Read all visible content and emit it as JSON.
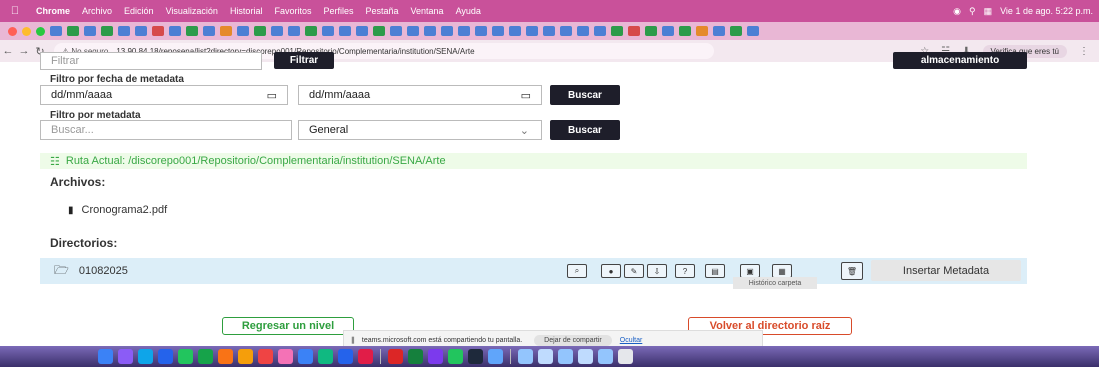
{
  "menubar": {
    "app": "Chrome",
    "items": [
      "Archivo",
      "Edición",
      "Visualización",
      "Historial",
      "Favoritos",
      "Perfiles",
      "Pestaña",
      "Ventana",
      "Ayuda"
    ],
    "clock": "Vie 1 de ago.  5:22 p.m."
  },
  "toolbar": {
    "security": "No seguro",
    "url": "13.90.84.18/reposena/list?directory=discorepo001/Repositorio/Complementaria/institution/SENA/Arte",
    "verify": "Verifica que eres tú"
  },
  "filters": {
    "filter_placeholder": "Filtrar",
    "filter_button": "Filtrar",
    "storage_button": "almacenamiento",
    "date_label": "Filtro por fecha de metadata",
    "date_from": "dd/mm/aaaa",
    "date_to": "dd/mm/aaaa",
    "search_button": "Buscar",
    "meta_label": "Filtro por metadata",
    "meta_placeholder": "Buscar...",
    "meta_select": "General",
    "meta_button": "Buscar"
  },
  "path": {
    "text": "Ruta Actual: /discorepo001/Repositorio/Complementaria/institution/SENA/Arte"
  },
  "files": {
    "title": "Archivos:",
    "items": [
      "Cronograma2.pdf"
    ]
  },
  "directories": {
    "title": "Directorios:",
    "items": [
      "01082025"
    ],
    "insert_button": "Insertar Metadata",
    "tooltip": "Histórico carpeta"
  },
  "footer": {
    "back_button": "Regresar un nivel",
    "root_button": "Volver al directorio raíz"
  },
  "share": {
    "message": "teams.microsoft.com está compartiendo tu pantalla.",
    "stop": "Dejar de compartir",
    "hide": "Ocultar"
  }
}
